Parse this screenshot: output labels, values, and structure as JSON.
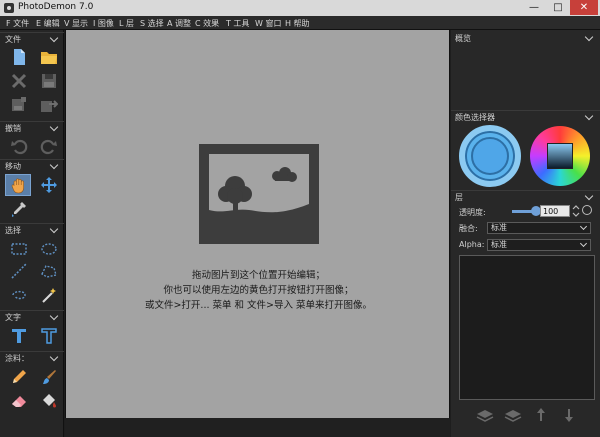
{
  "window": {
    "title": "PhotoDemon 7.0"
  },
  "menu": [
    {
      "label": "F 文件"
    },
    {
      "label": "E 编辑"
    },
    {
      "label": "V 显示"
    },
    {
      "label": "I 图像"
    },
    {
      "label": "L 层"
    },
    {
      "label": "S 选择"
    },
    {
      "label": "A 调整"
    },
    {
      "label": "C 效果"
    },
    {
      "label": "T 工具"
    },
    {
      "label": "W 窗口"
    },
    {
      "label": "H 帮助"
    }
  ],
  "toolbox": {
    "sections": [
      {
        "label": "文件"
      },
      {
        "label": "撤销"
      },
      {
        "label": "移动"
      },
      {
        "label": "选择"
      },
      {
        "label": "文字"
      },
      {
        "label": "涂料："
      }
    ]
  },
  "canvas": {
    "hint_lines": [
      "拖动图片到这个位置开始编辑；",
      "你也可以使用左边的黄色打开按钮打开图像；",
      "或文件>打开... 菜单 和 文件>导入 菜单来打开图像。"
    ]
  },
  "right_panel": {
    "overview_label": "概览",
    "color_selector_label": "颜色选择器",
    "layers_label": "层",
    "opacity_label": "透明度:",
    "opacity_value": "100",
    "blend_label": "融合:",
    "blend_value": "标准",
    "alpha_label": "Alpha:",
    "alpha_value": "标准"
  },
  "colors": {
    "accent": "#5b7fa8",
    "canvas_bg": "#a3a3a3",
    "panel_bg": "#282828",
    "primary_color_swatch": "#4fa6e8"
  }
}
